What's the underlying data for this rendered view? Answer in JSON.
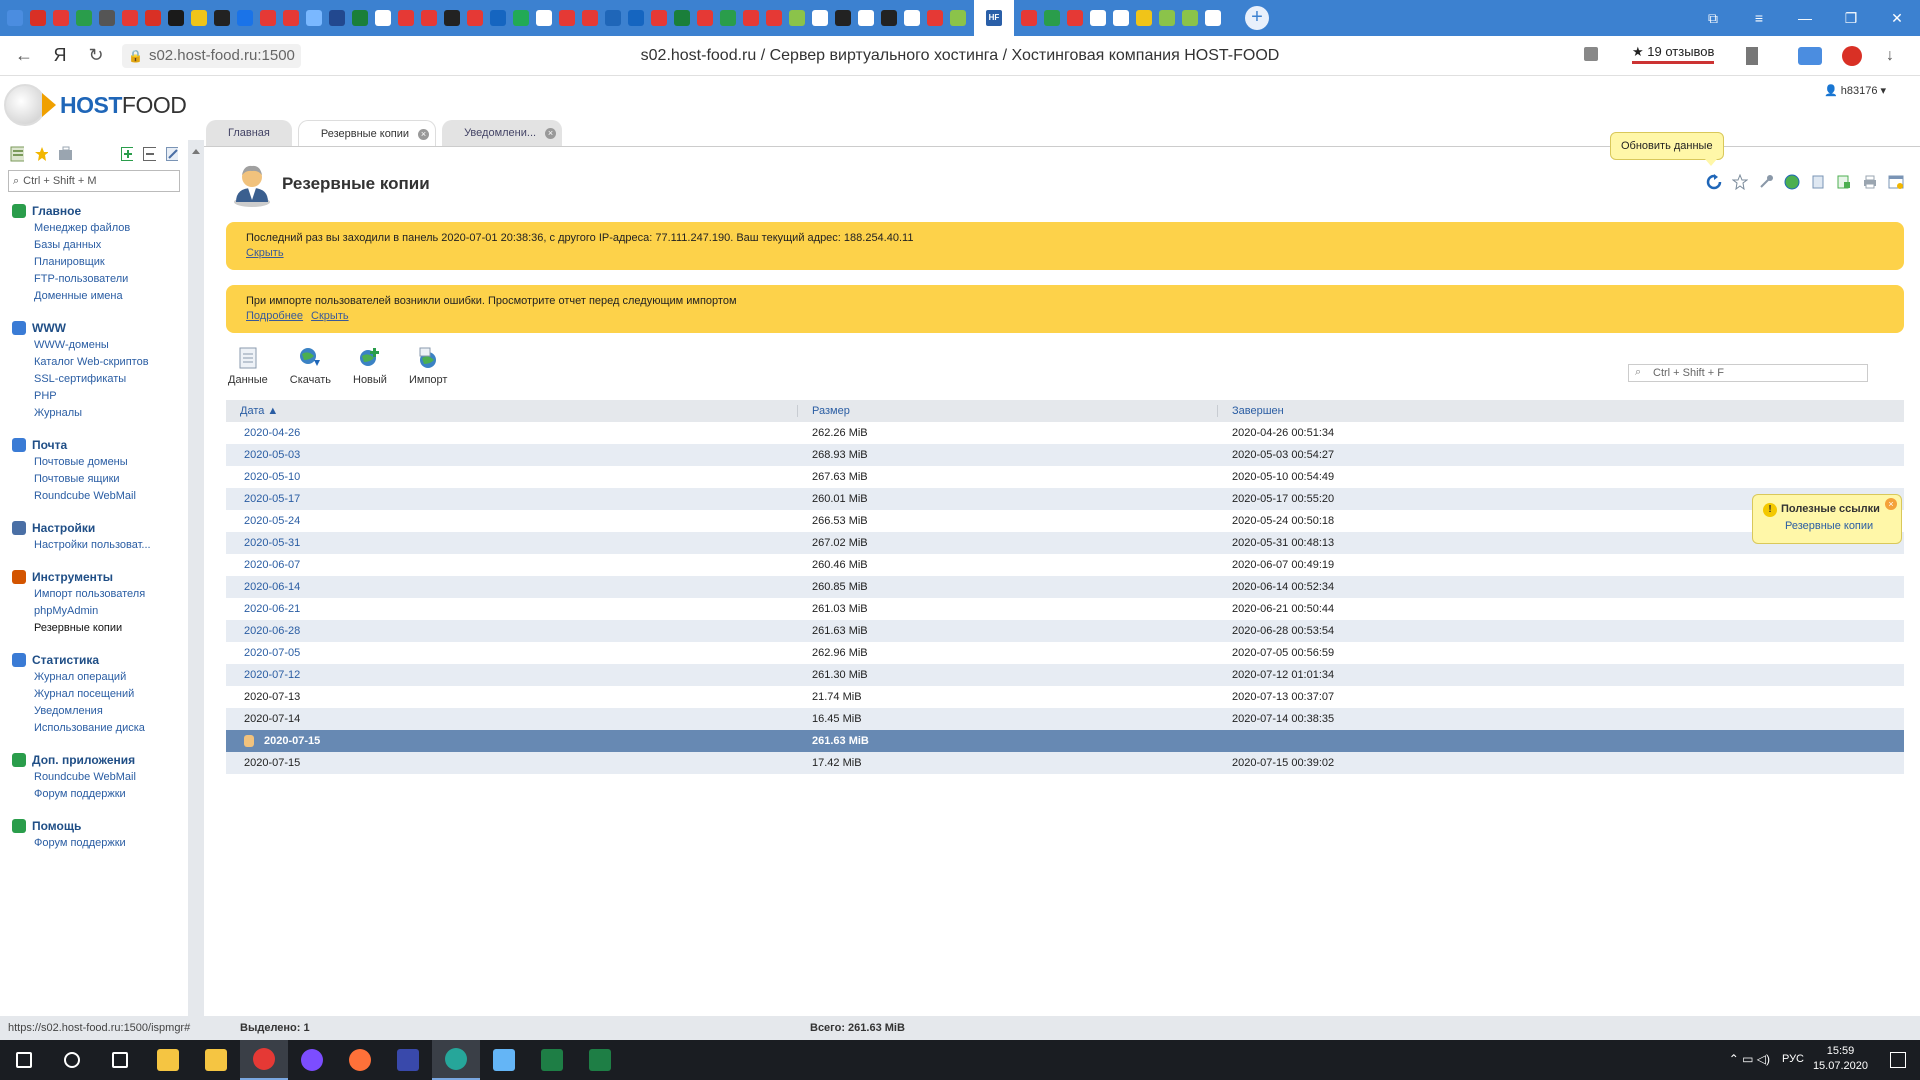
{
  "browser": {
    "url": "s02.host-food.ru:1500",
    "page_title": "s02.host-food.ru / Сервер виртуального хостинга / Хостинговая компания HOST-FOOD",
    "reviews": "★ 19 отзывов",
    "tab_colors": [
      "#4b8de0",
      "#d93025",
      "#e53935",
      "#2a9d4b",
      "#555555",
      "#e53935",
      "#d93025",
      "#1a1a1a",
      "#f0c419",
      "#222222",
      "#1a73e8",
      "#e53935",
      "#e53935",
      "#7ab8ff",
      "#22488f",
      "#1a7f3a",
      "#ffffff",
      "#e53935",
      "#e53935",
      "#222",
      "#e53935",
      "#1565c0",
      "#22aa55",
      "#ffffff",
      "#e53935",
      "#e53935",
      "#1f66b8",
      "#1565c0",
      "#e53935",
      "#1a7f3a",
      "#e53935",
      "#2a9d4b",
      "#e53935",
      "#e53935",
      "#8bc34a",
      "#ffffff",
      "#222222",
      "#ffffff",
      "#222222",
      "#ffffff",
      "#e53935",
      "#8bc34a",
      "#e53935",
      "#2a9d4b",
      "#e53935",
      "#ffffff",
      "#ffffff",
      "#f0c419",
      "#8bc34a",
      "#8bc34a",
      "#ffffff"
    ],
    "active_tab_icon": "HF"
  },
  "user": {
    "name": "h83176"
  },
  "logo": {
    "part1": "HOST",
    "part2": "FOOD"
  },
  "sidebar": {
    "search_placeholder": "Ctrl + Shift + M",
    "groups": [
      {
        "title": "Главное",
        "color": "#2a9d4b",
        "items": [
          "Менеджер файлов",
          "Базы данных",
          "Планировщик",
          "FTP-пользователи",
          "Доменные имена"
        ]
      },
      {
        "title": "WWW",
        "color": "#3a7bd5",
        "items": [
          "WWW-домены",
          "Каталог Web-скриптов",
          "SSL-сертификаты",
          "PHP",
          "Журналы"
        ]
      },
      {
        "title": "Почта",
        "color": "#3a7bd5",
        "items": [
          "Почтовые домены",
          "Почтовые ящики",
          "Roundcube WebMail"
        ]
      },
      {
        "title": "Настройки",
        "color": "#4a6fa5",
        "items": [
          "Настройки пользоват..."
        ]
      },
      {
        "title": "Инструменты",
        "color": "#d35400",
        "items": [
          "Импорт пользователя",
          "phpMyAdmin",
          "Резервные копии"
        ]
      },
      {
        "title": "Статистика",
        "color": "#3a7bd5",
        "items": [
          "Журнал операций",
          "Журнал посещений",
          "Уведомления",
          "Использование диска"
        ]
      },
      {
        "title": "Доп. приложения",
        "color": "#2a9d4b",
        "items": [
          "Roundcube WebMail",
          "Форум поддержки"
        ]
      },
      {
        "title": "Помощь",
        "color": "#2a9d4b",
        "items": [
          "Форум поддержки"
        ]
      }
    ]
  },
  "tabs": [
    {
      "label": "Главная"
    },
    {
      "label": "Резервные копии"
    },
    {
      "label": "Уведомлени..."
    }
  ],
  "content": {
    "title": "Резервные копии",
    "tooltip": "Обновить данные",
    "notice1": {
      "text": "Последний раз вы заходили в панель 2020-07-01 20:38:36, с другого IP-адреса: 77.111.247.190. Ваш текущий адрес: 188.254.40.11",
      "hide": "Скрыть"
    },
    "notice2": {
      "text": "При импорте пользователей возникли ошибки. Просмотрите отчет перед следующим импортом",
      "more": "Подробнее",
      "hide": "Скрыть"
    },
    "toolbar": [
      {
        "label": "Данные"
      },
      {
        "label": "Скачать"
      },
      {
        "label": "Новый"
      },
      {
        "label": "Импорт"
      }
    ],
    "filter_placeholder": "Ctrl + Shift + F",
    "columns": [
      "Дата ▲",
      "Размер",
      "Завершен"
    ],
    "rows": [
      {
        "date": "2020-04-26",
        "size": "262.26 MiB",
        "done": "2020-04-26 00:51:34",
        "link": true
      },
      {
        "date": "2020-05-03",
        "size": "268.93 MiB",
        "done": "2020-05-03 00:54:27",
        "link": true
      },
      {
        "date": "2020-05-10",
        "size": "267.63 MiB",
        "done": "2020-05-10 00:54:49",
        "link": true
      },
      {
        "date": "2020-05-17",
        "size": "260.01 MiB",
        "done": "2020-05-17 00:55:20",
        "link": true
      },
      {
        "date": "2020-05-24",
        "size": "266.53 MiB",
        "done": "2020-05-24 00:50:18",
        "link": true
      },
      {
        "date": "2020-05-31",
        "size": "267.02 MiB",
        "done": "2020-05-31 00:48:13",
        "link": true
      },
      {
        "date": "2020-06-07",
        "size": "260.46 MiB",
        "done": "2020-06-07 00:49:19",
        "link": true
      },
      {
        "date": "2020-06-14",
        "size": "260.85 MiB",
        "done": "2020-06-14 00:52:34",
        "link": true
      },
      {
        "date": "2020-06-21",
        "size": "261.03 MiB",
        "done": "2020-06-21 00:50:44",
        "link": true
      },
      {
        "date": "2020-06-28",
        "size": "261.63 MiB",
        "done": "2020-06-28 00:53:54",
        "link": true
      },
      {
        "date": "2020-07-05",
        "size": "262.96 MiB",
        "done": "2020-07-05 00:56:59",
        "link": true
      },
      {
        "date": "2020-07-12",
        "size": "261.30 MiB",
        "done": "2020-07-12 01:01:34",
        "link": true
      },
      {
        "date": "2020-07-13",
        "size": "21.74 MiB",
        "done": "2020-07-13 00:37:07",
        "link": false
      },
      {
        "date": "2020-07-14",
        "size": "16.45 MiB",
        "done": "2020-07-14 00:38:35",
        "link": false
      },
      {
        "date": "2020-07-15",
        "size": "261.63 MiB",
        "done": "",
        "link": true,
        "selected": true
      },
      {
        "date": "2020-07-15",
        "size": "17.42 MiB",
        "done": "2020-07-15 00:39:02",
        "link": false
      }
    ],
    "useful": {
      "title": "Полезные ссылки",
      "link": "Резервные копии"
    }
  },
  "status": {
    "url": "https://s02.host-food.ru:1500/ispmgr#",
    "selected": "Выделено: 1",
    "total": "Всего: 261.63 MiB"
  },
  "taskbar": {
    "apps": [
      {
        "name": "windows-start-icon",
        "color": "#ffffff"
      },
      {
        "name": "search-icon",
        "color": "#ffffff"
      },
      {
        "name": "task-view-icon",
        "color": "#ffffff"
      },
      {
        "name": "folder-tool-icon",
        "color": "#f5c542"
      },
      {
        "name": "explorer-icon",
        "color": "#f5c542"
      },
      {
        "name": "yandex-browser-icon",
        "color": "#e53935"
      },
      {
        "name": "opera-icon",
        "color": "#7c4dff"
      },
      {
        "name": "firefox-icon",
        "color": "#ff7139"
      },
      {
        "name": "save-app-icon",
        "color": "#3949ab"
      },
      {
        "name": "app-2bs-icon",
        "color": "#26a69a"
      },
      {
        "name": "notepad-icon",
        "color": "#64b5f6"
      },
      {
        "name": "excel-icon",
        "color": "#1e7e45"
      },
      {
        "name": "chart-app-icon",
        "color": "#1e7e45"
      }
    ],
    "lang": "РУС",
    "time": "15:59",
    "date": "15.07.2020"
  }
}
